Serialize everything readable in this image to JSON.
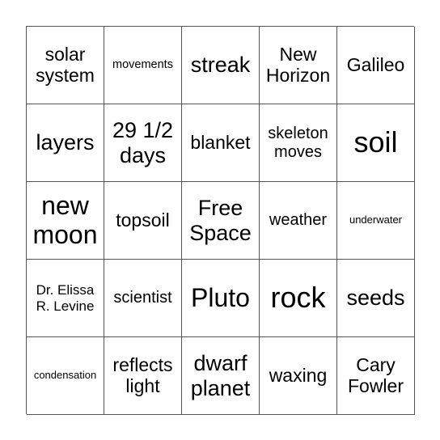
{
  "card": {
    "rows": [
      [
        "solar system",
        "movements",
        "streak",
        "New Horizon",
        "Galileo"
      ],
      [
        "layers",
        "29 1/2 days",
        "blanket",
        "skeleton moves",
        "soil"
      ],
      [
        "new moon",
        "topsoil",
        "Free Space",
        "weather",
        "underwater"
      ],
      [
        "Dr. Elissa R. Levine",
        "scientist",
        "Pluto",
        "rock",
        "seeds"
      ],
      [
        "condensation",
        "reflects light",
        "dwarf planet",
        "waxing",
        "Cary Fowler"
      ]
    ]
  },
  "colors": {
    "grid_line": "#555555",
    "text": "#000000",
    "background": "#ffffff"
  }
}
